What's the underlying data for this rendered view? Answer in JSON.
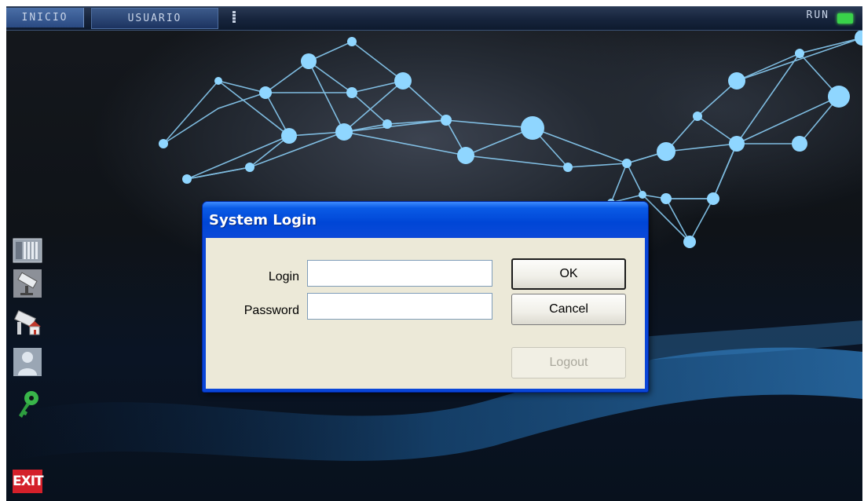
{
  "topbar": {
    "tabs": [
      {
        "label": "INICIO"
      },
      {
        "label": "USUARIO"
      }
    ],
    "status_label": "RUN",
    "status_color": "#39d24a"
  },
  "sidebar": {
    "icons": [
      "rack-server-icon",
      "security-camera-icon",
      "home-camera-icon",
      "user-icon",
      "key-icon",
      "exit-sign-icon"
    ],
    "exit_label": "EXIT"
  },
  "dialog": {
    "title": "System Login",
    "login_label": "Login",
    "login_value": "",
    "password_label": "Password",
    "password_value": "",
    "ok_label": "OK",
    "cancel_label": "Cancel",
    "logout_label": "Logout"
  },
  "colors": {
    "dialog_frame": "#0a46d8",
    "dialog_body": "#ece9d8",
    "network_lines": "#8fd6ff"
  }
}
